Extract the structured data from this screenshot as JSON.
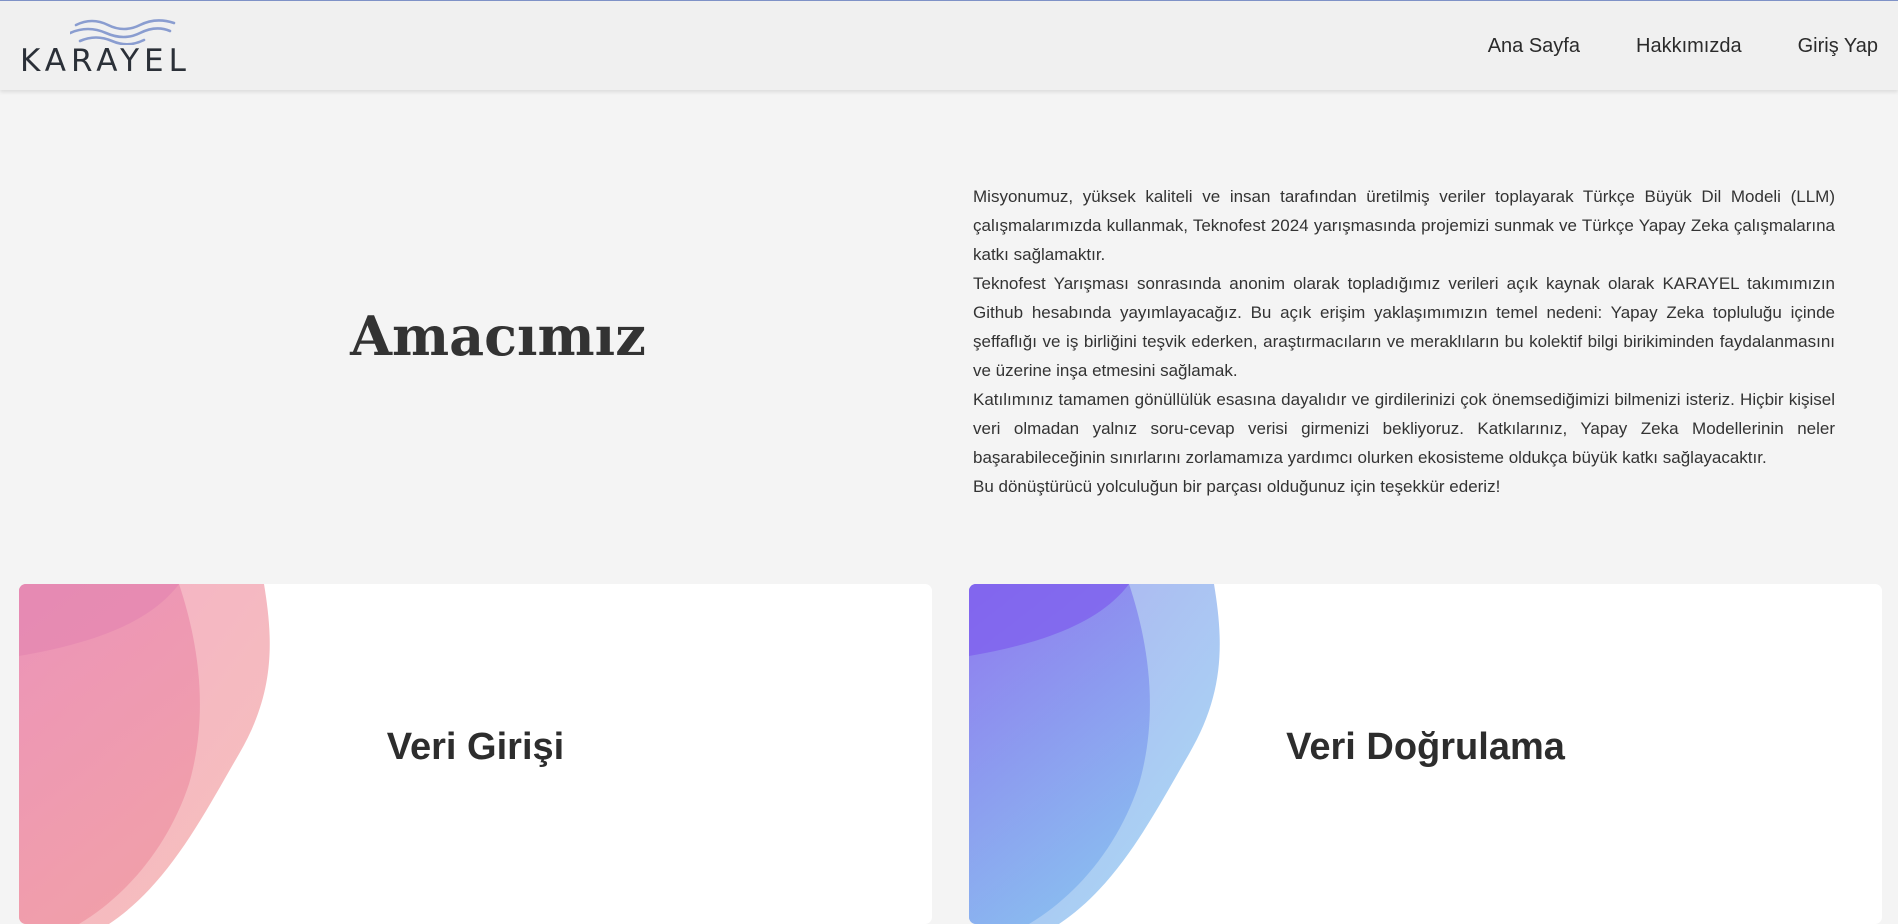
{
  "brand": {
    "name": "KARAYEL",
    "wave_color": "#8a9dd0"
  },
  "nav": {
    "items": [
      {
        "label": "Ana Sayfa"
      },
      {
        "label": "Hakkımızda"
      },
      {
        "label": "Giriş Yap"
      }
    ]
  },
  "hero": {
    "title": "Amacımız"
  },
  "mission": {
    "paragraphs": [
      "Misyonumuz, yüksek kaliteli ve insan tarafından üretilmiş veriler toplayarak Türkçe Büyük Dil Modeli (LLM) çalışmalarımızda kullanmak, Teknofest 2024 yarışmasında projemizi sunmak ve Türkçe Yapay Zeka çalışmalarına katkı sağlamaktır.",
      "Teknofest Yarışması sonrasında anonim olarak topladığımız verileri açık kaynak olarak KARAYEL takımımızın Github hesabında yayımlayacağız. Bu açık erişim yaklaşımımızın temel nedeni: Yapay Zeka topluluğu içinde şeffaflığı ve iş birliğini teşvik ederken, araştırmacıların ve meraklıların bu kolektif bilgi birikiminden faydalanmasını ve üzerine inşa etmesini sağlamak.",
      "Katılımınız tamamen gönüllülük esasına dayalıdır ve girdilerinizi çok önemsediğimizi bilmenizi isteriz. Hiçbir kişisel veri olmadan yalnız soru-cevap verisi girmenizi bekliyoruz. Katkılarınız, Yapay Zeka Modellerinin neler başarabileceğinin sınırlarını zorlamamıza yardımcı olurken ekosisteme oldukça büyük katkı sağlayacaktır.",
      "Bu dönüştürücü yolculuğun bir parçası olduğunuz için teşekkür ederiz!"
    ]
  },
  "cards": [
    {
      "title": "Veri Girişi",
      "accent_colors": [
        "#e98db5",
        "#f4b0b0"
      ]
    },
    {
      "title": "Veri Doğrulama",
      "accent_colors": [
        "#8b6cf0",
        "#9fd3f2"
      ]
    }
  ]
}
